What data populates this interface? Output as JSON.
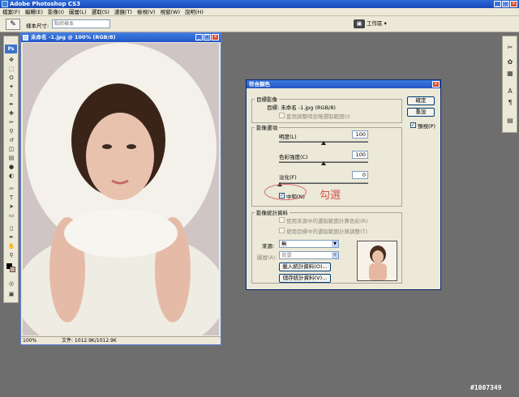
{
  "app": {
    "title": "Adobe Photoshop CS3"
  },
  "menu": [
    "檔案(F)",
    "編輯(E)",
    "影像(I)",
    "圖層(L)",
    "選取(S)",
    "濾鏡(T)",
    "檢視(V)",
    "視窗(W)",
    "說明(H)"
  ],
  "options": {
    "sample_label": "樣本尺寸:",
    "sample_value": "點狀樣本",
    "workspace": "工作區 ▾"
  },
  "document": {
    "title": "未命名 -1.jpg @ 100% (RGB/8)",
    "zoom": "100%",
    "file_info": "文件: 1012.9K/1012.9K"
  },
  "dialog": {
    "title": "符合顏色",
    "ok": "確定",
    "reset": "重設",
    "preview": "預視(P)",
    "target_group": "目標影像",
    "target_label": "目標: 未命名 -1.jpg (RGB/8)",
    "ignore_selection": "套用調整時忽略選取範圍(I)",
    "options_group": "影像選項",
    "luminance_label": "明度(L)",
    "luminance_value": "100",
    "intensity_label": "色彩強度(C)",
    "intensity_value": "100",
    "fade_label": "淡化(F)",
    "fade_value": "0",
    "neutralize": "中和(N)",
    "stats_group": "影像統計資料",
    "use_source_sel": "使用來源中的選取範圍計算色彩(R)",
    "use_target_sel": "使用目標中的選取範圍計算調整(T)",
    "source_label": "來源:",
    "source_value": "無",
    "layer_label": "圖層(A):",
    "layer_value": "背景",
    "load_stats": "載入統計資料(O)...",
    "save_stats": "儲存統計資料(V)..."
  },
  "annotation": "勾選",
  "watermark": "#1007349",
  "colors": {
    "titlebar": "#2456c6",
    "workspace": "#6e6e6e",
    "panel": "#ece9d8",
    "annotation": "#d9534f"
  }
}
